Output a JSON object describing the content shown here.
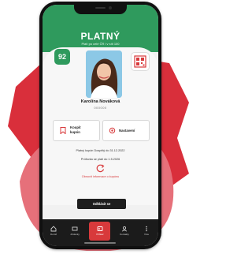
{
  "status": {
    "title": "PLATNÝ",
    "subtitle": "Platí po celé ČR i v síti 100",
    "score": "92",
    "color": "#2f9a5d"
  },
  "user": {
    "name": "Karolína Nováková",
    "masked_id": "000000"
  },
  "actions": {
    "coupon_label_line1": "Koupit",
    "coupon_label_line2": "kupón",
    "settings_label": "Nastavení"
  },
  "coupon": {
    "valid_until": "Platný kupón Dospělý do 31.12.2022",
    "renewal": "Prüfovka se platí do 1.5.2026",
    "info_link": "Obnovit informace o kupónu"
  },
  "primary_button": "Odhlásit se",
  "tabbar": {
    "items": [
      {
        "label": "Domů",
        "icon": "home-icon"
      },
      {
        "label": "Jízdenky",
        "icon": "ticket-icon"
      },
      {
        "label": "Průkaz",
        "icon": "card-icon"
      },
      {
        "label": "Kontakty",
        "icon": "contact-icon"
      },
      {
        "label": "Více",
        "icon": "more-icon"
      }
    ]
  },
  "colors": {
    "accent_red": "#d8393b",
    "background_blob": "#e05a5d"
  }
}
